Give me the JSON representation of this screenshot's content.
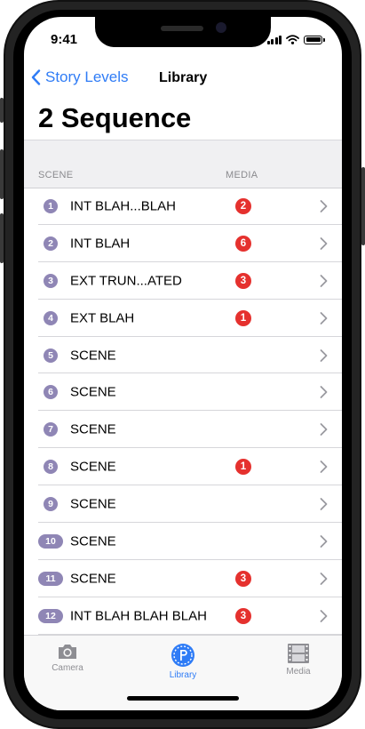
{
  "status": {
    "time": "9:41"
  },
  "nav": {
    "back_label": "Story Levels",
    "title": "Library",
    "large_title": "2 Sequence"
  },
  "columns": {
    "scene": "SCENE",
    "media": "MEDIA"
  },
  "colors": {
    "accent": "#2f7cf6",
    "badge": "#e5312e",
    "scene_number": "#8f86b5"
  },
  "scenes": [
    {
      "number": "1",
      "name": "INT BLAH...BLAH",
      "media": "2"
    },
    {
      "number": "2",
      "name": "INT BLAH",
      "media": "6"
    },
    {
      "number": "3",
      "name": "EXT TRUN...ATED",
      "media": "3"
    },
    {
      "number": "4",
      "name": "EXT BLAH",
      "media": "1"
    },
    {
      "number": "5",
      "name": "SCENE",
      "media": ""
    },
    {
      "number": "6",
      "name": "SCENE",
      "media": ""
    },
    {
      "number": "7",
      "name": "SCENE",
      "media": ""
    },
    {
      "number": "8",
      "name": "SCENE",
      "media": "1"
    },
    {
      "number": "9",
      "name": "SCENE",
      "media": ""
    },
    {
      "number": "10",
      "name": "SCENE",
      "media": ""
    },
    {
      "number": "11",
      "name": "SCENE",
      "media": "3"
    },
    {
      "number": "12",
      "name": "INT BLAH BLAH BLAH",
      "media": "3"
    }
  ],
  "tabs": [
    {
      "label": "Camera",
      "icon": "camera-icon"
    },
    {
      "label": "Library",
      "icon": "library-icon",
      "active": true
    },
    {
      "label": "Media",
      "icon": "film-icon"
    }
  ]
}
